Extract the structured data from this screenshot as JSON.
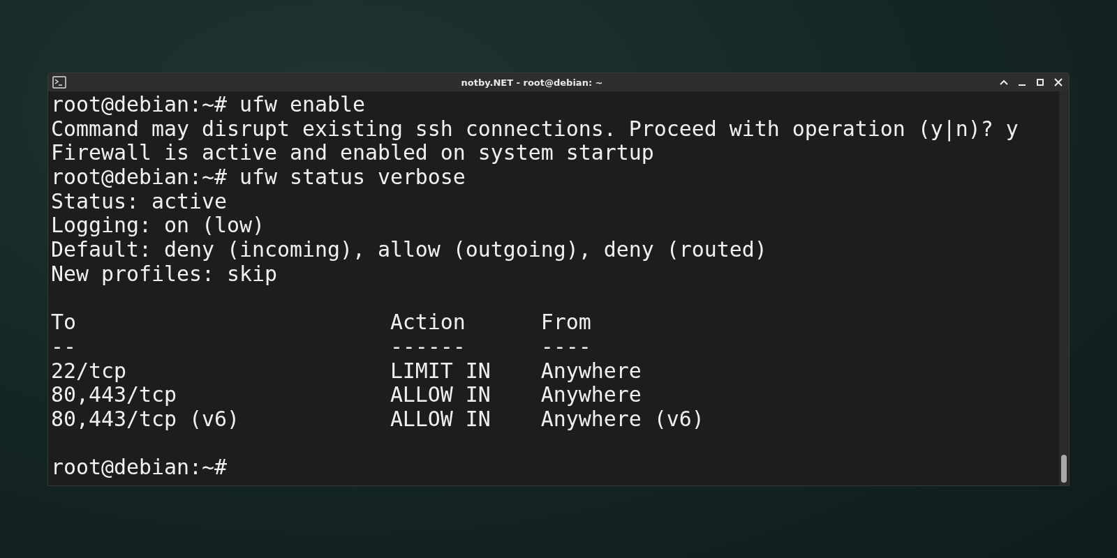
{
  "window": {
    "title": "notby.NET - root@debian: ~"
  },
  "terminal": {
    "lines": [
      {
        "kind": "text",
        "text": "root@debian:~# ufw enable"
      },
      {
        "kind": "text",
        "text": "Command may disrupt existing ssh connections. Proceed with operation (y|n)? y"
      },
      {
        "kind": "text",
        "text": "Firewall is active and enabled on system startup"
      },
      {
        "kind": "text",
        "text": "root@debian:~# ufw status verbose"
      },
      {
        "kind": "text",
        "text": "Status: active"
      },
      {
        "kind": "text",
        "text": "Logging: on (low)"
      },
      {
        "kind": "text",
        "text": "Default: deny (incoming), allow (outgoing), deny (routed)"
      },
      {
        "kind": "text",
        "text": "New profiles: skip"
      },
      {
        "kind": "blank"
      },
      {
        "kind": "row",
        "cells": [
          "To",
          "Action",
          "From"
        ]
      },
      {
        "kind": "row",
        "cells": [
          "--",
          "------",
          "----"
        ]
      },
      {
        "kind": "row",
        "cells": [
          "22/tcp",
          "LIMIT IN",
          "Anywhere"
        ]
      },
      {
        "kind": "row",
        "cells": [
          "80,443/tcp",
          "ALLOW IN",
          "Anywhere"
        ]
      },
      {
        "kind": "row",
        "cells": [
          "80,443/tcp (v6)",
          "ALLOW IN",
          "Anywhere (v6)"
        ]
      },
      {
        "kind": "blank"
      },
      {
        "kind": "text",
        "text": "root@debian:~#"
      }
    ]
  }
}
